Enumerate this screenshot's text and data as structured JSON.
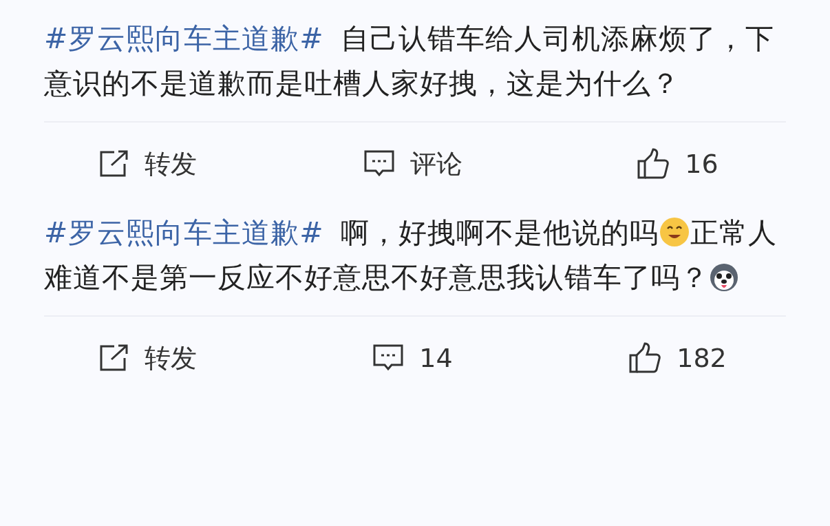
{
  "posts": [
    {
      "hashtag": "#罗云熙向车主道歉#",
      "body": [
        {
          "kind": "text",
          "text": "自己认错车给人司机添麻烦了，下意识的不是道歉而是吐槽人家好拽，这是为什么？"
        }
      ],
      "actions": [
        {
          "kind": "forward",
          "label": "转发"
        },
        {
          "kind": "comment",
          "label": "评论"
        },
        {
          "kind": "like",
          "label": "16"
        }
      ]
    },
    {
      "hashtag": "#罗云熙向车主道歉#",
      "body": [
        {
          "kind": "text",
          "text": "啊，好拽啊不是他说的吗"
        },
        {
          "kind": "smile"
        },
        {
          "kind": "text",
          "text": "正常人难道不是第一反应不好意思不好意思我认错车了吗？"
        },
        {
          "kind": "husky"
        }
      ],
      "actions": [
        {
          "kind": "forward",
          "label": "转发"
        },
        {
          "kind": "comment",
          "label": "14"
        },
        {
          "kind": "like",
          "label": "182"
        }
      ]
    }
  ]
}
